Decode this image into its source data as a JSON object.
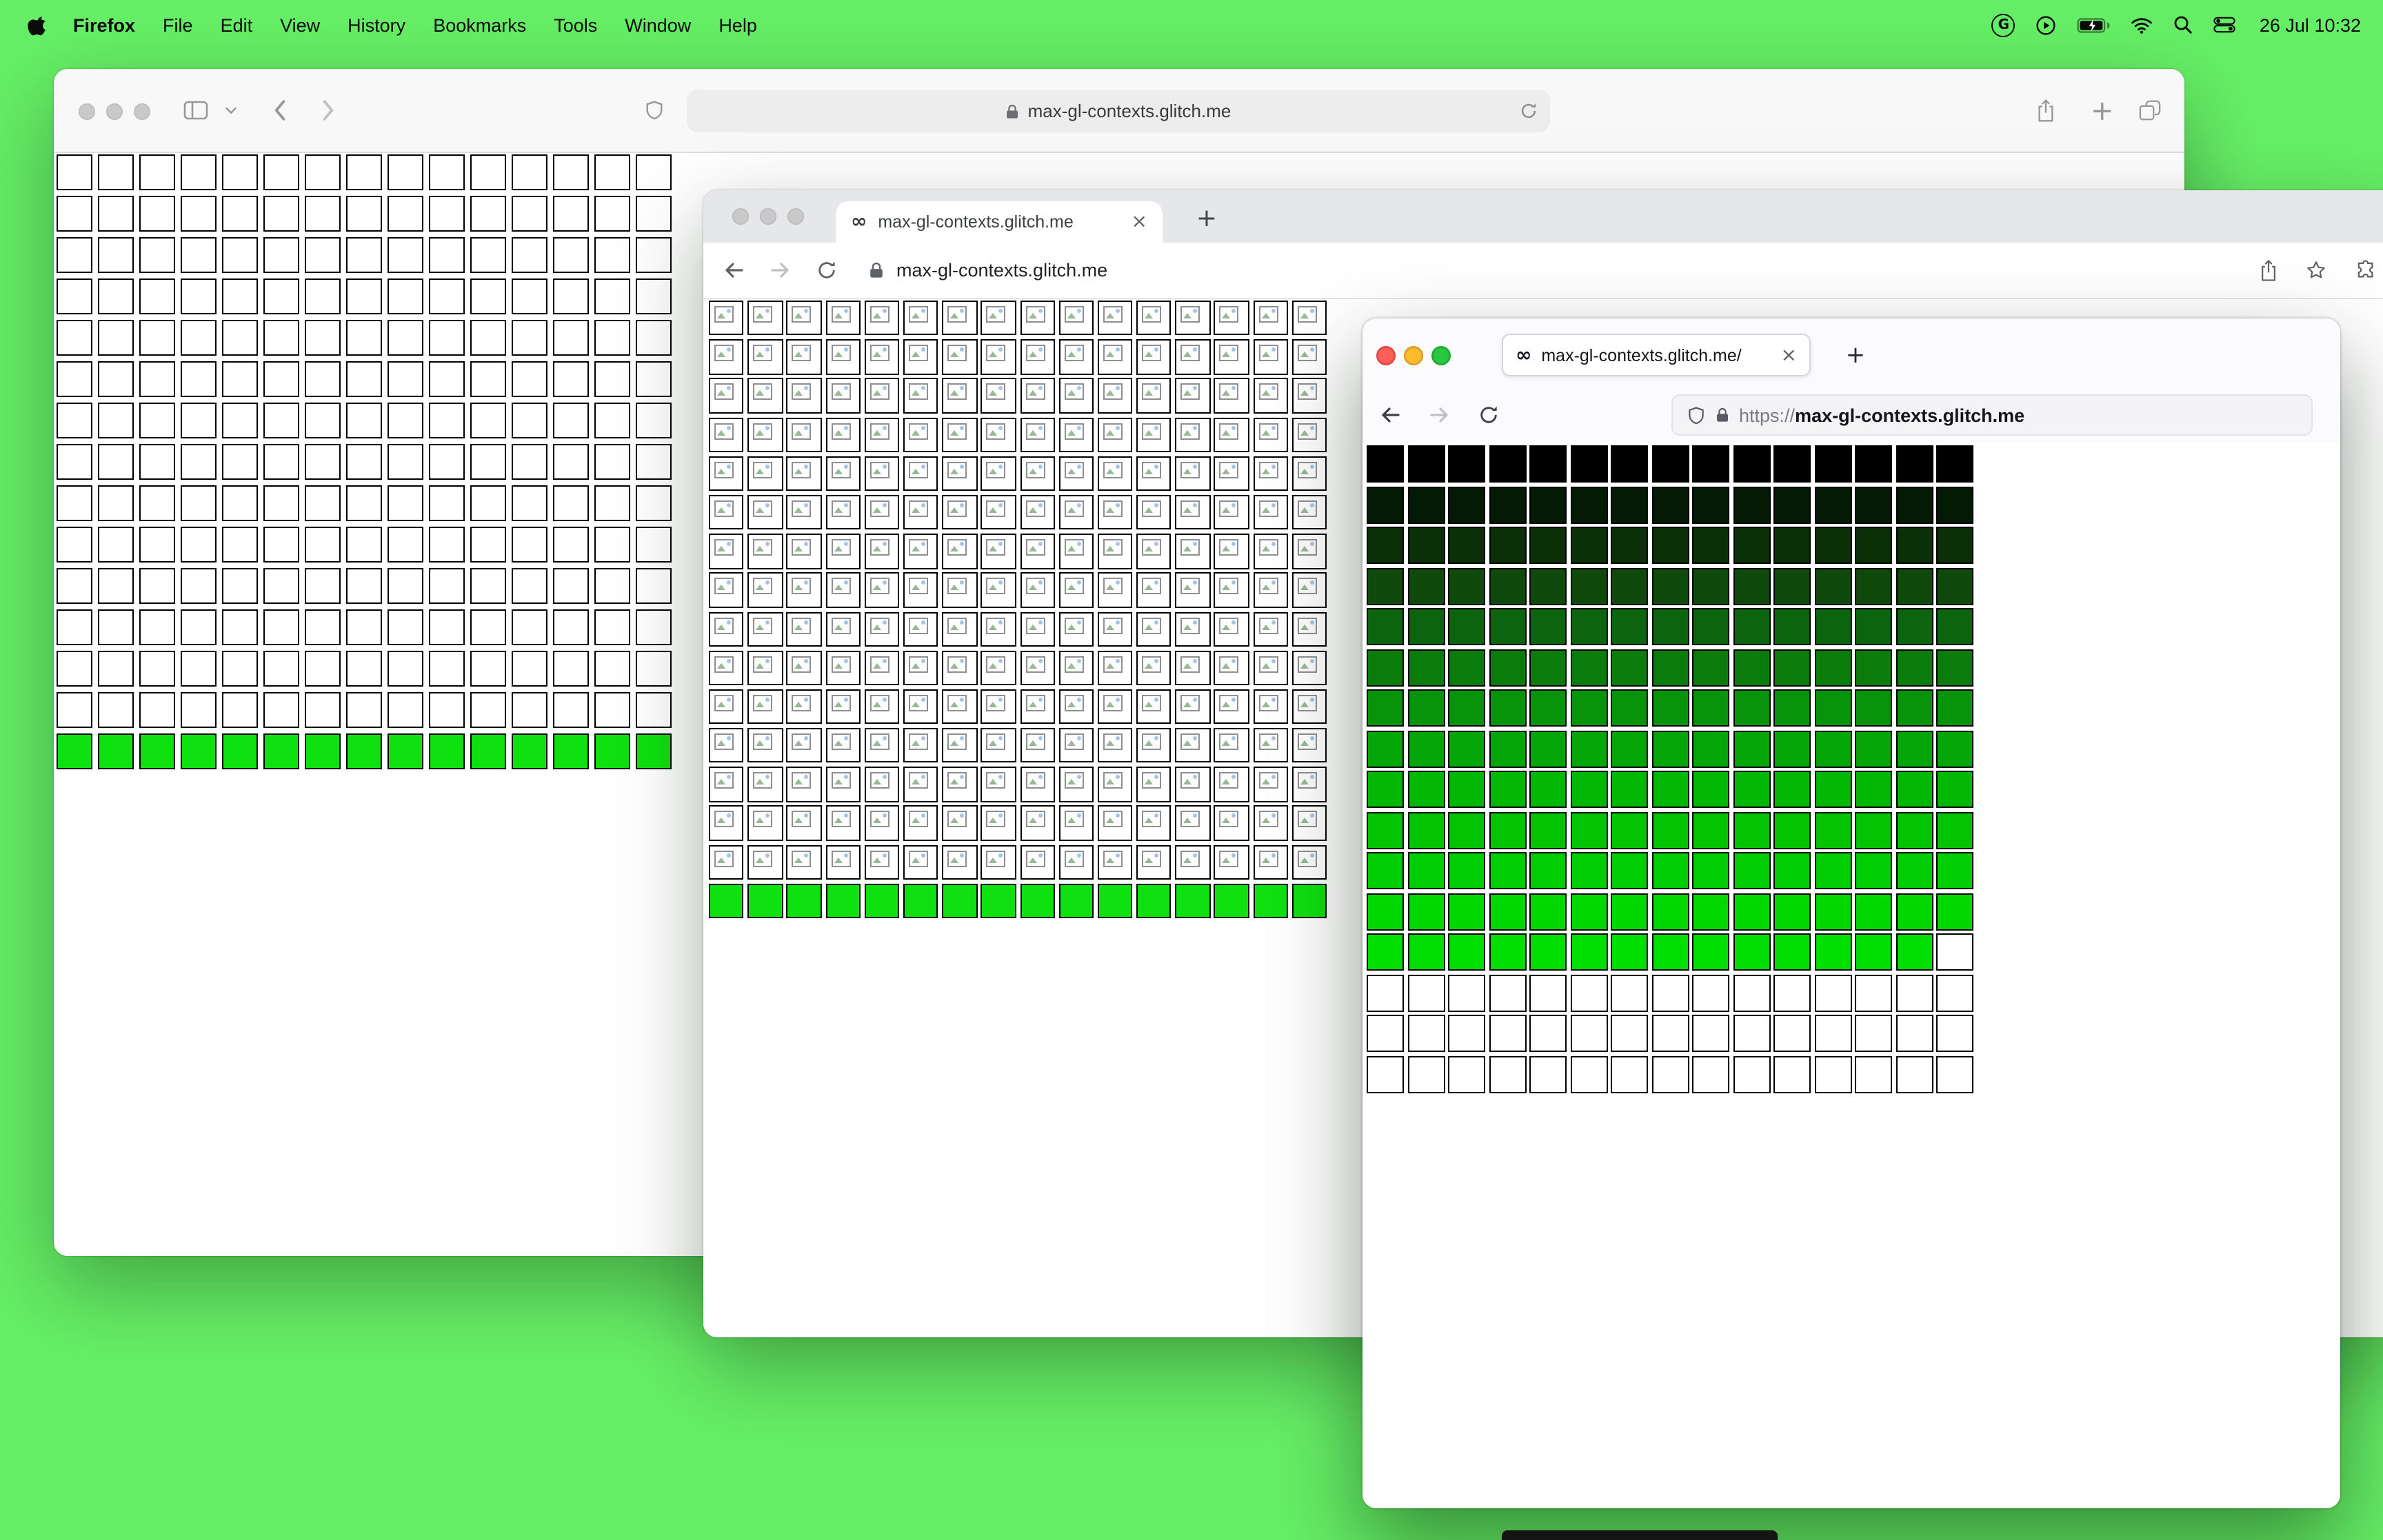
{
  "menubar": {
    "app_name": "Firefox",
    "menus": [
      "File",
      "Edit",
      "View",
      "History",
      "Bookmarks",
      "Tools",
      "Window",
      "Help"
    ],
    "clock": "26 Jul 10:32",
    "status_icons": [
      "google-badge-icon",
      "play-circle-icon",
      "battery-charging-icon",
      "wifi-icon",
      "spotlight-search-icon",
      "control-center-icon"
    ]
  },
  "glyphs": {
    "g_badge": "G",
    "plus": "+",
    "close": "×",
    "infinity": "∞"
  },
  "safari_window": {
    "url": "max-gl-contexts.glitch.me"
  },
  "chrome_window": {
    "tab_title": "max-gl-contexts.glitch.me",
    "url": "max-gl-contexts.glitch.me"
  },
  "firefox_window": {
    "tab_title": "max-gl-contexts.glitch.me/",
    "url_scheme": "https://",
    "url_host": "max-gl-contexts.glitch.me"
  },
  "colors": {
    "desktop_green": "#66ef66",
    "canvas_green": "#0fe00f",
    "firefox_bright_green": "#00df00",
    "cell_border": "#000000"
  },
  "grids": {
    "safari": {
      "cols": 15,
      "cell": 26,
      "gap": 4,
      "border": "#000000",
      "borderW": 1.5,
      "rows": [
        {
          "color": "#ffffff",
          "repeat": 14
        },
        {
          "color": "#0fe00f",
          "repeat": 1
        }
      ]
    },
    "chrome": {
      "cols": 16,
      "cell": 25.4,
      "gap": 2.8,
      "border": "#000000",
      "borderW": 1.2,
      "rows": [
        {
          "color": "#ffffff",
          "repeat": 15,
          "icon": true
        },
        {
          "color": "#0fe00f",
          "repeat": 1
        }
      ]
    },
    "firefox": {
      "cols": 15,
      "cell": 27,
      "gap": 2.5,
      "border": "#000000",
      "borderW": 1.2,
      "rows": [
        {
          "color": "#000000"
        },
        {
          "color": "#041a04"
        },
        {
          "color": "#0b3008"
        },
        {
          "color": "#0f4a0c"
        },
        {
          "color": "#0c640e"
        },
        {
          "color": "#0a7c0c"
        },
        {
          "color": "#07930a"
        },
        {
          "color": "#05a607"
        },
        {
          "color": "#03b805"
        },
        {
          "color": "#02c403"
        },
        {
          "color": "#01ce02"
        },
        {
          "color": "#00d800"
        },
        {
          "color": "#00df00",
          "count": 14,
          "rest": "#ffffff"
        },
        {
          "color": "#ffffff",
          "repeat": 3
        }
      ]
    }
  }
}
